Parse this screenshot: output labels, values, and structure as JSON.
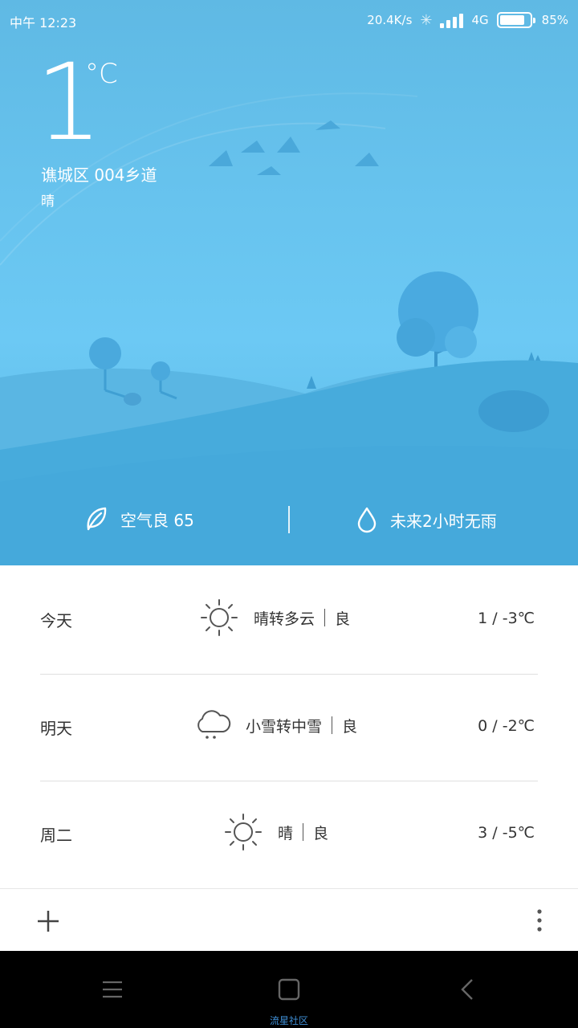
{
  "status_bar": {
    "time": "中午 12:23",
    "network_speed": "20.4K/s",
    "network_type": "4G",
    "battery": "85%",
    "battery_level": 0.85
  },
  "current": {
    "temperature": "1",
    "unit": "°C",
    "location": "谯城区 004乡道",
    "condition": "晴"
  },
  "info": {
    "air_quality": "空气良 65",
    "rain_forecast": "未来2小时无雨"
  },
  "forecast": [
    {
      "day": "今天",
      "icon": "sun-icon",
      "condition": "晴转多云",
      "aqi": "良",
      "temp": "1 / -3℃"
    },
    {
      "day": "明天",
      "icon": "snow-cloud-icon",
      "condition": "小雪转中雪",
      "aqi": "良",
      "temp": "0 / -2℃"
    },
    {
      "day": "周二",
      "icon": "sun-icon",
      "condition": "晴",
      "aqi": "良",
      "temp": "3 / -5℃"
    }
  ],
  "navbar": {
    "watermark": "流星社区"
  },
  "colors": {
    "sky": "#67c3ee",
    "hill": "#4aaede",
    "text_dark": "#333333"
  }
}
